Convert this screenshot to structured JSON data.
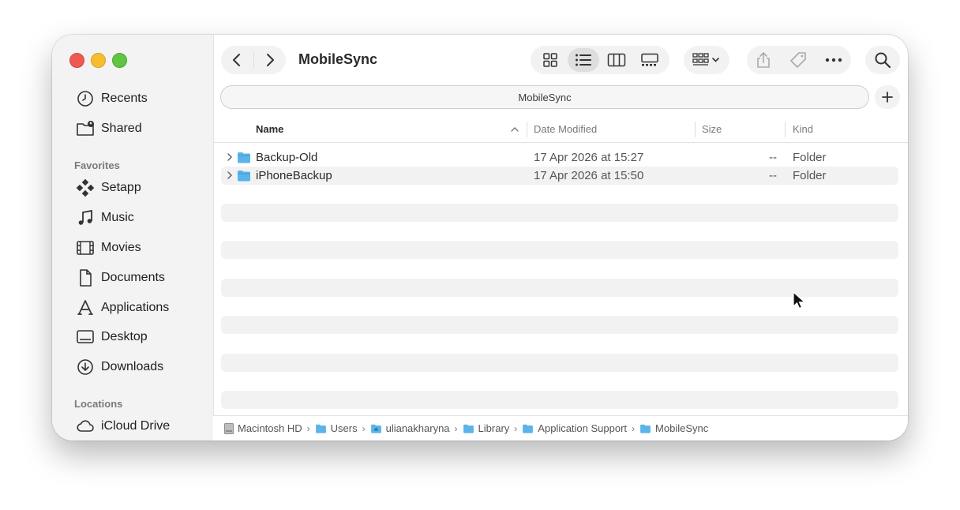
{
  "window": {
    "title": "MobileSync"
  },
  "toolbar": {
    "back_icon": "chevron-left-icon",
    "forward_icon": "chevron-right-icon",
    "views": [
      "icon-view",
      "list-view",
      "column-view",
      "gallery-view"
    ],
    "active_view": "list-view"
  },
  "tab": {
    "label": "MobileSync"
  },
  "sidebar": {
    "top_items": [
      {
        "label": "Recents",
        "icon": "clock-icon"
      },
      {
        "label": "Shared",
        "icon": "shared-folder-icon"
      }
    ],
    "favorites_header": "Favorites",
    "favorites": [
      {
        "label": "Setapp",
        "icon": "setapp-icon"
      },
      {
        "label": "Music",
        "icon": "music-note-icon"
      },
      {
        "label": "Movies",
        "icon": "film-icon"
      },
      {
        "label": "Documents",
        "icon": "document-icon"
      },
      {
        "label": "Applications",
        "icon": "applications-icon"
      },
      {
        "label": "Desktop",
        "icon": "desktop-icon"
      },
      {
        "label": "Downloads",
        "icon": "download-icon"
      }
    ],
    "locations_header": "Locations",
    "locations": [
      {
        "label": "iCloud Drive",
        "icon": "cloud-icon"
      }
    ]
  },
  "columns": {
    "name": "Name",
    "date_modified": "Date Modified",
    "size": "Size",
    "kind": "Kind"
  },
  "rows": [
    {
      "name": "Backup-Old",
      "date": "17 Apr 2026 at 15:27",
      "size": "--",
      "kind": "Folder"
    },
    {
      "name": "iPhoneBackup",
      "date": "17 Apr 2026 at 15:50",
      "size": "--",
      "kind": "Folder"
    }
  ],
  "pathbar": {
    "crumbs": [
      "Macintosh HD",
      "Users",
      "ulianakharyna",
      "Library",
      "Application Support",
      "MobileSync"
    ],
    "separator": "›"
  },
  "colors": {
    "folder": "#5ab4ea",
    "accent": "#ee5a52"
  }
}
